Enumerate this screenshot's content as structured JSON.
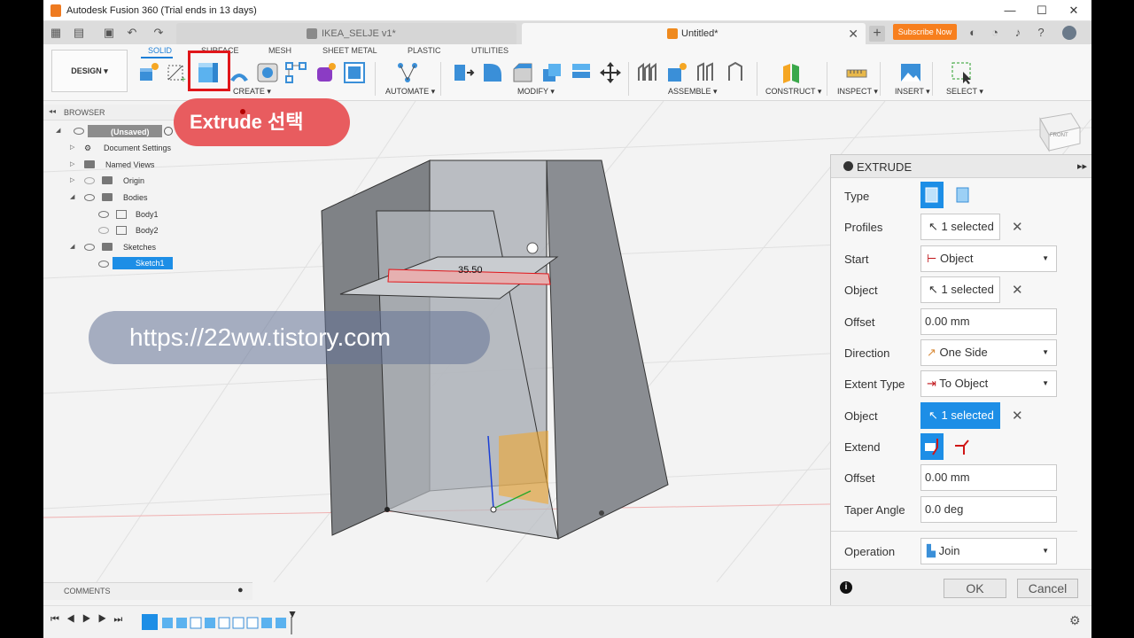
{
  "window": {
    "title": "Autodesk Fusion 360 (Trial ends in 13 days)",
    "minimize": "—",
    "maximize": "☐",
    "close": "✕"
  },
  "tabs": [
    {
      "label": "IKEA_SELJE v1*",
      "close": "✕"
    },
    {
      "label": "Untitled*",
      "close": "✕"
    }
  ],
  "new_tab": "+",
  "subscribe_label": "Subscribe Now",
  "toolbar": {
    "design_label": "DESIGN ▾",
    "workspace_tabs": [
      "SOLID",
      "SURFACE",
      "MESH",
      "SHEET METAL",
      "PLASTIC",
      "UTILITIES"
    ],
    "groups": [
      "CREATE ▾",
      "AUTOMATE ▾",
      "MODIFY ▾",
      "ASSEMBLE ▾",
      "CONSTRUCT ▾",
      "INSPECT ▾",
      "INSERT ▾",
      "SELECT ▾"
    ]
  },
  "browser": {
    "title": "BROWSER",
    "root": "(Unsaved)",
    "items": [
      "Document Settings",
      "Named Views",
      "Origin",
      "Bodies",
      "Body1",
      "Body2",
      "Sketches",
      "Sketch1"
    ]
  },
  "callout": "Extrude 선택",
  "watermark": "https://22ww.tistory.com",
  "dimension_label": "35.50",
  "viewcube_label": "FRONT",
  "comments_label": "COMMENTS",
  "extrude_panel": {
    "title": "EXTRUDE",
    "rows": {
      "type": "Type",
      "profiles": "Profiles",
      "profiles_value": "1 selected",
      "start": "Start",
      "start_value": "Object",
      "object": "Object",
      "object_value": "1 selected",
      "offset": "Offset",
      "offset_value": "0.00 mm",
      "direction": "Direction",
      "direction_value": "One Side",
      "extent_type": "Extent Type",
      "extent_type_value": "To Object",
      "object2": "Object",
      "object2_value": "1 selected",
      "extend": "Extend",
      "offset2": "Offset",
      "offset2_value": "0.00 mm",
      "taper_angle": "Taper Angle",
      "taper_angle_value": "0.0 deg",
      "operation": "Operation",
      "operation_value": "Join"
    },
    "ok_label": "OK",
    "cancel_label": "Cancel"
  },
  "colors": {
    "accent_blue": "#1d8ee6",
    "callout_red": "#e85c5f",
    "highlight_red": "#e0161a",
    "subscribe_orange": "#f77f1e"
  }
}
